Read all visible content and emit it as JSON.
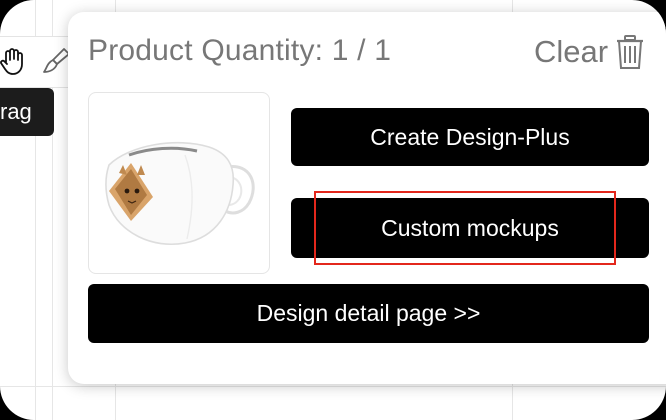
{
  "tooltip": {
    "text": "rag"
  },
  "toolbar": {
    "icons": [
      "hand-drag-icon",
      "brush-icon"
    ]
  },
  "popup": {
    "title": "Product Quantity: 1 / 1",
    "clear_label": "Clear",
    "clear_icon": "trash-icon",
    "buttons": {
      "create_design_plus": "Create Design-Plus",
      "custom_mockups": "Custom mockups",
      "design_detail_page": "Design detail page >>"
    }
  },
  "colors": {
    "button_bg": "#000000",
    "button_text": "#ffffff",
    "title_text": "#777777",
    "highlight_box": "#e3271c",
    "tooltip_bg": "#1c1c1c"
  }
}
